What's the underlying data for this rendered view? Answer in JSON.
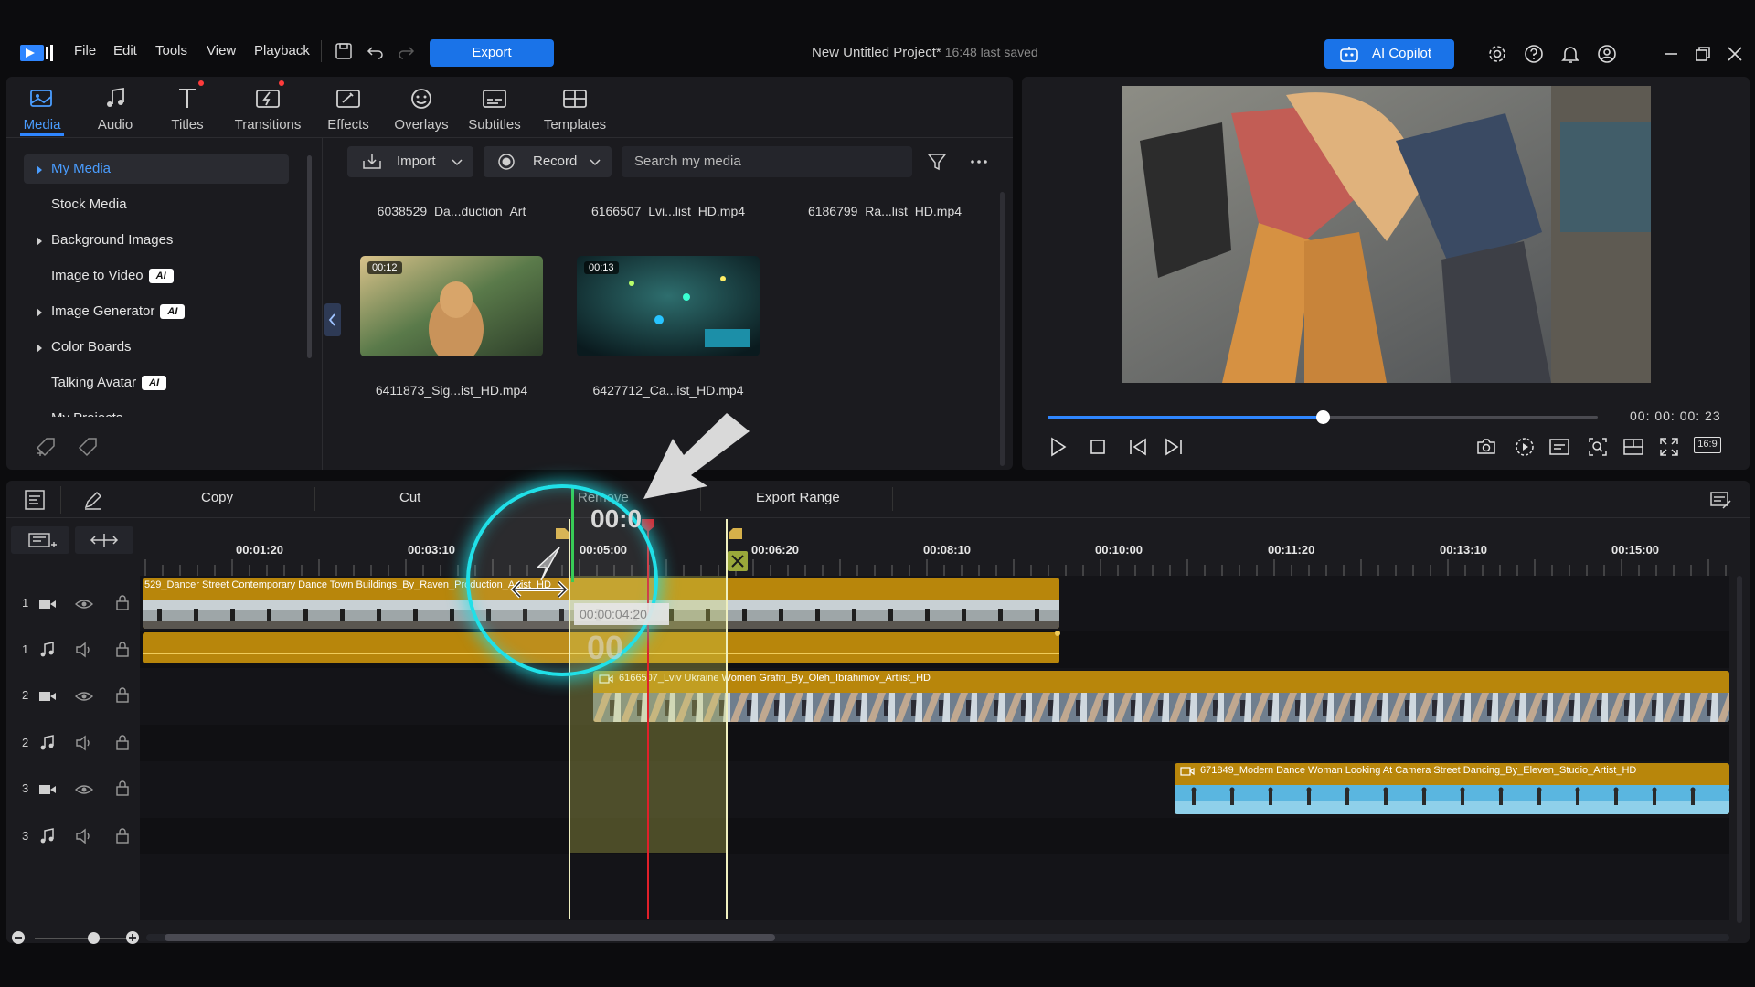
{
  "menu": {
    "file": "File",
    "edit": "Edit",
    "tools": "Tools",
    "view": "View",
    "playback": "Playback",
    "export": "Export"
  },
  "project": {
    "title": "New Untitled Project*",
    "saved": "16:48 last saved"
  },
  "copilot": "AI Copilot",
  "tabs": [
    {
      "label": "Media"
    },
    {
      "label": "Audio"
    },
    {
      "label": "Titles"
    },
    {
      "label": "Transitions"
    },
    {
      "label": "Effects"
    },
    {
      "label": "Overlays"
    },
    {
      "label": "Subtitles"
    },
    {
      "label": "Templates"
    }
  ],
  "sidebar": {
    "items": [
      {
        "label": "My Media"
      },
      {
        "label": "Stock Media"
      },
      {
        "label": "Background Images"
      },
      {
        "label": "Image to Video",
        "badge": "AI"
      },
      {
        "label": "Image Generator",
        "badge": "AI"
      },
      {
        "label": "Color Boards"
      },
      {
        "label": "Talking Avatar",
        "badge": "AI"
      },
      {
        "label": "My Projects"
      }
    ]
  },
  "library": {
    "import": "Import",
    "record": "Record",
    "search_placeholder": "Search my media",
    "row1": [
      "6038529_Da...duction_Art",
      "6166507_Lvi...list_HD.mp4",
      "6186799_Ra...list_HD.mp4"
    ],
    "items": [
      {
        "name": "6411873_Sig...ist_HD.mp4",
        "duration": "00:12"
      },
      {
        "name": "6427712_Ca...ist_HD.mp4",
        "duration": "00:13"
      }
    ]
  },
  "preview": {
    "timecode": "00: 00: 00: 23",
    "progress": 0.5,
    "aspect": "16:9"
  },
  "timeline": {
    "tools": {
      "copy": "Copy",
      "cut": "Cut",
      "remove": "Remove",
      "export_range": "Export Range"
    },
    "ruler": [
      "00:01:20",
      "00:03:10",
      "00:05:00",
      "00:06:20",
      "00:08:10",
      "00:10:00",
      "00:11:20",
      "00:13:10",
      "00:15:00"
    ],
    "tracks": [
      "1",
      "1",
      "2",
      "2",
      "3",
      "3"
    ],
    "clips": {
      "clip1": "529_Dancer Street Contemporary Dance Town Buildings_By_Raven_Production_Artist_HD",
      "clip2": "6166507_Lviv Ukraine Women Grafiti_By_Oleh_Ibrahimov_Artlist_HD",
      "clip3": "671849_Modern Dance Woman Looking At Camera Street Dancing_By_Eleven_Studio_Artist_HD"
    },
    "overlay_time": "00:0",
    "overlay_tc": "00:00:04:20",
    "overlay_big": "00"
  },
  "colors": {
    "accent": "#1a73e8",
    "clip_gold": "#b8860b",
    "selection": "#d8d86a"
  }
}
